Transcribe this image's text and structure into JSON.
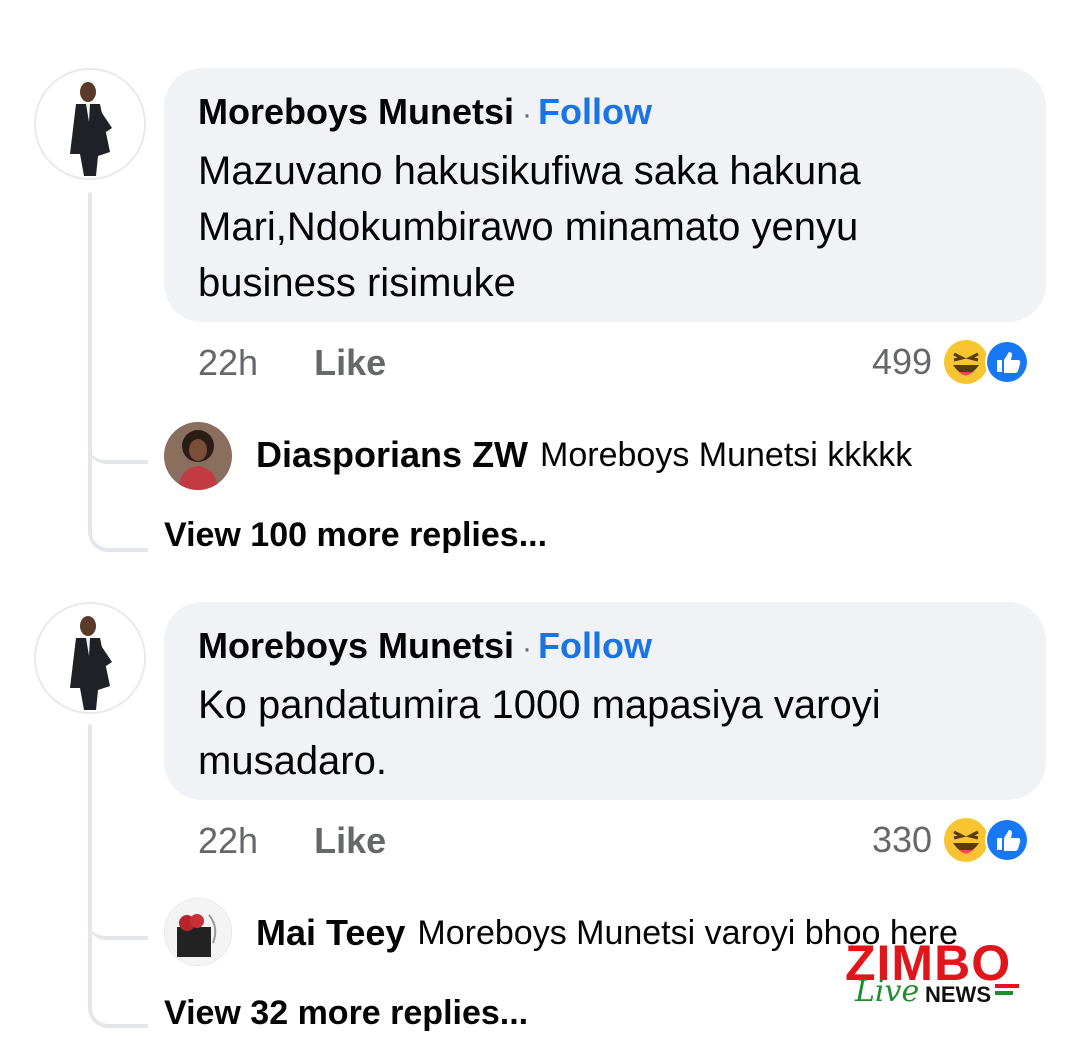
{
  "comments": [
    {
      "author": "Moreboys Munetsi",
      "separator": "·",
      "follow_label": "Follow",
      "text": "Mazuvano hakusikufiwa saka hakuna Mari,Ndokumbirawo minamato yenyu business risimuke",
      "time": "22h",
      "like_label": "Like",
      "reaction_count": "499",
      "reply": {
        "author": "Diasporians ZW",
        "text": "Moreboys Munetsi kkkkk"
      },
      "view_more": "View 100 more replies..."
    },
    {
      "author": "Moreboys Munetsi",
      "separator": "·",
      "follow_label": "Follow",
      "text": "Ko pandatumira 1000 mapasiya varoyi musadaro.",
      "time": "22h",
      "like_label": "Like",
      "reaction_count": "330",
      "reply": {
        "author": "Mai Teey",
        "text": "Moreboys Munetsi varoyi bhoo here"
      },
      "view_more": "View 32 more replies..."
    }
  ],
  "watermark": {
    "zimbo": "ZIMBO",
    "live": "Live",
    "news": "NEWS"
  },
  "icons": [
    "laugh-reaction-icon",
    "like-reaction-icon"
  ],
  "colors": {
    "accent": "#1b74e4",
    "bubble": "#f0f2f5",
    "watermark_red": "#e0161b",
    "watermark_green": "#1c8f2a"
  }
}
